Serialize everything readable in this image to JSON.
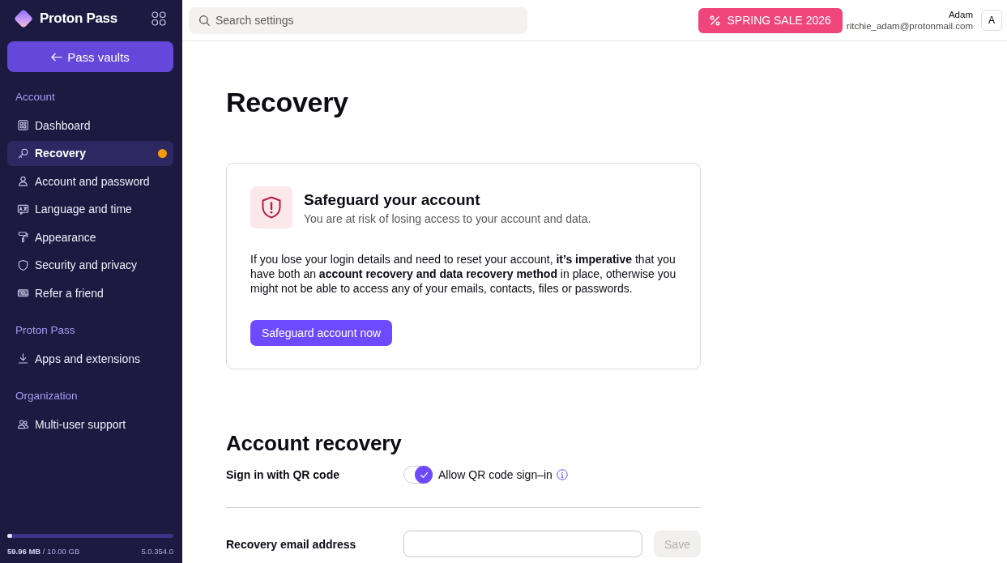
{
  "app": {
    "name": "Proton Pass"
  },
  "sidebar": {
    "back_button": "Pass vaults",
    "sections": [
      {
        "title": "Account",
        "items": [
          {
            "label": "Dashboard",
            "selected": false,
            "notification_dot": false
          },
          {
            "label": "Recovery",
            "selected": true,
            "notification_dot": true
          },
          {
            "label": "Account and password",
            "selected": false,
            "notification_dot": false
          },
          {
            "label": "Language and time",
            "selected": false,
            "notification_dot": false
          },
          {
            "label": "Appearance",
            "selected": false,
            "notification_dot": false
          },
          {
            "label": "Security and privacy",
            "selected": false,
            "notification_dot": false
          },
          {
            "label": "Refer a friend",
            "selected": false,
            "notification_dot": false
          }
        ]
      },
      {
        "title": "Proton Pass",
        "items": [
          {
            "label": "Apps and extensions",
            "selected": false,
            "notification_dot": false
          }
        ]
      },
      {
        "title": "Organization",
        "items": [
          {
            "label": "Multi-user support",
            "selected": false,
            "notification_dot": false
          }
        ]
      }
    ],
    "storage": {
      "level": 0.006,
      "text": "**59.96 MB** / 10.00 GB"
    },
    "version": "5.0.354.0"
  },
  "top_bar": {
    "search": {
      "placeholder": "Search settings"
    },
    "promo_button": "SPRING SALE 2026",
    "user": {
      "name": "Adam",
      "email": "ritchie_adam@protonmail.com",
      "initial": "A"
    }
  },
  "page": {
    "title": "Recovery",
    "alert_card": {
      "title": "Safeguard your account",
      "subtitle": "You are at risk of losing access to your account and data.",
      "body": "If you lose your login details and need to reset your account, **it’s imperative** that you have both an **account recovery and data recovery method** in place, otherwise you might not be able to access any of your emails, contacts, files or passwords.",
      "button": "Safeguard account now"
    },
    "section": {
      "title": "Account recovery",
      "rows": [
        {
          "kind": "toggle",
          "label": "Sign in with QR code",
          "toggle_label": "Allow QR code sign–in",
          "checked": true
        },
        {
          "kind": "input",
          "label": "Recovery email address",
          "button": "Save",
          "disabled": true
        }
      ]
    }
  }
}
